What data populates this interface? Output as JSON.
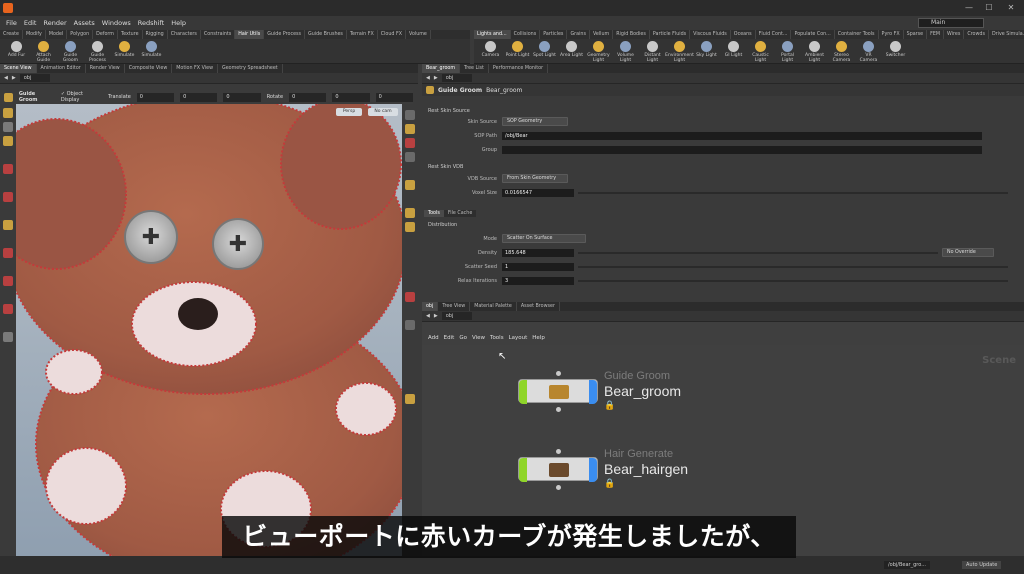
{
  "title_bar": {
    "minimize": "—",
    "maximize": "☐",
    "close": "✕"
  },
  "menu": [
    "File",
    "Edit",
    "Render",
    "Assets",
    "Windows",
    "Redshift",
    "Help"
  ],
  "desktop": "Main",
  "shelf_left": {
    "tabs": [
      "Create",
      "Modify",
      "Model",
      "Polygon",
      "Deform",
      "Texture",
      "Rigging",
      "Characters",
      "Constraints",
      "Hair Utils",
      "Guide Process",
      "Guide Brushes",
      "Terrain FX",
      "Cloud FX",
      "Volume"
    ],
    "active_tab": "Hair Utils",
    "tools": [
      "Add Fur",
      "Attach Guide",
      "Guide Groom",
      "Guide Process",
      "Simulate",
      "Simulate"
    ]
  },
  "shelf_right": {
    "tabs": [
      "Lights and...",
      "Collisions",
      "Particles",
      "Grains",
      "Vellum",
      "Rigid Bodies",
      "Particle Fluids",
      "Viscous Fluids",
      "Oceans",
      "Fluid Cont...",
      "Populate Con...",
      "Container Tools",
      "Pyro FX",
      "Sparse",
      "FEM",
      "Wires",
      "Crowds",
      "Drive Simula..."
    ],
    "active_tab": "Lights and...",
    "tools": [
      "Camera",
      "Point Light",
      "Spot Light",
      "Area Light",
      "Geometry Light",
      "Volume Light",
      "Distant Light",
      "Environment Light",
      "Sky Light",
      "GI Light",
      "Caustic Light",
      "Portal Light",
      "Ambient Light",
      "Stereo Camera",
      "VR Camera",
      "Switcher"
    ]
  },
  "viewport_tabs": [
    "Scene View",
    "Animation Editor",
    "Render View",
    "Composite View",
    "Motion FX View",
    "Geometry Spreadsheet"
  ],
  "viewport_path": "obj",
  "viewport_toolbar": {
    "tool": "Guide Groom",
    "option": "Object Display",
    "translate_label": "Translate",
    "translate": [
      "0",
      "0",
      "0"
    ],
    "rotate_label": "Rotate",
    "rotate": [
      "0",
      "0",
      "0"
    ],
    "camera_menu": "Persp",
    "cam_menu": "No cam"
  },
  "param_tabs": [
    "Bear_groom",
    "Tree List",
    "Performance Monitor"
  ],
  "param_path": "obj",
  "param_header": {
    "node_type": "Guide Groom",
    "node_name": "Bear_groom"
  },
  "params": {
    "rest_skin_source_section": "Rest Skin Source",
    "skin_source_label": "Skin Source",
    "skin_source_value": "SOP Geometry",
    "sop_path_label": "SOP Path",
    "sop_path_value": "/obj/Bear",
    "group_label": "Group",
    "group_value": "",
    "rest_skin_vdb_section": "Rest Skin VDB",
    "vdb_source_label": "VDB Source",
    "vdb_source_value": "From Skin Geometry",
    "voxel_size_label": "Voxel Size",
    "voxel_size_value": "0.0166547",
    "tabs": [
      "Tools",
      "File Cache"
    ],
    "distribution_section": "Distribution",
    "mode_label": "Mode",
    "mode_value": "Scatter On Surface",
    "density_label": "Density",
    "density_value": "185.648",
    "density_override": "No Override",
    "scatter_seed_label": "Scatter Seed",
    "scatter_seed_value": "1",
    "relax_iterations_label": "Relax Iterations",
    "relax_iterations_value": "3"
  },
  "network_tabs": [
    "obj",
    "Tree View",
    "Material Palette",
    "Asset Browser"
  ],
  "network_path": "obj",
  "network_menu": [
    "Add",
    "Edit",
    "Go",
    "View",
    "Tools",
    "Layout",
    "Help"
  ],
  "network_label": "Scene",
  "nodes": [
    {
      "type": "Guide Groom",
      "name": "Bear_groom"
    },
    {
      "type": "Hair Generate",
      "name": "Bear_hairgen"
    }
  ],
  "status": {
    "path": "/obj/Bear_gro...",
    "update": "Auto Update"
  },
  "subtitle": "ビューポートに赤いカーブが発生しましたが、",
  "colors": {
    "node_flag_green": "#8fd52a",
    "node_flag_blue": "#3a8df0",
    "houdini_orange": "#e8641e"
  }
}
